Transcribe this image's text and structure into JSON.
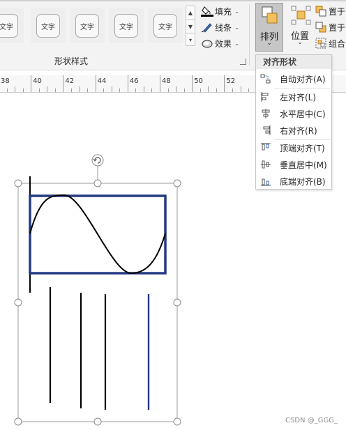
{
  "ribbon": {
    "shape_styles": {
      "group_label": "形状样式",
      "style_items": [
        "文字",
        "文字",
        "文字",
        "文字",
        "文字"
      ]
    },
    "format": {
      "fill_label": "填充",
      "line_label": "线条",
      "effect_label": "效果"
    },
    "arrange": {
      "arrange_label": "排列",
      "position_label": "位置",
      "bring_front_label": "置于",
      "send_back_label": "置于",
      "group_label": "组合"
    }
  },
  "ruler": {
    "labels": [
      "38",
      "40",
      "42",
      "44",
      "46",
      "48",
      "50",
      "52"
    ]
  },
  "align_menu": {
    "title": "对齐形状",
    "items": [
      {
        "label": "自动对齐(A)",
        "icon": "auto-align-icon"
      },
      {
        "label": "左对齐(L)",
        "icon": "align-left-icon"
      },
      {
        "label": "水平居中(C)",
        "icon": "align-center-horizontal-icon"
      },
      {
        "label": "右对齐(R)",
        "icon": "align-right-icon"
      },
      {
        "label": "顶端对齐(T)",
        "icon": "align-top-icon"
      },
      {
        "label": "垂直居中(M)",
        "icon": "align-middle-vertical-icon"
      },
      {
        "label": "底端对齐(B)",
        "icon": "align-bottom-icon"
      }
    ]
  },
  "canvas": {
    "accent_color": "#233a84",
    "line_color": "#000000"
  },
  "watermark": "CSDN @_GGG_"
}
